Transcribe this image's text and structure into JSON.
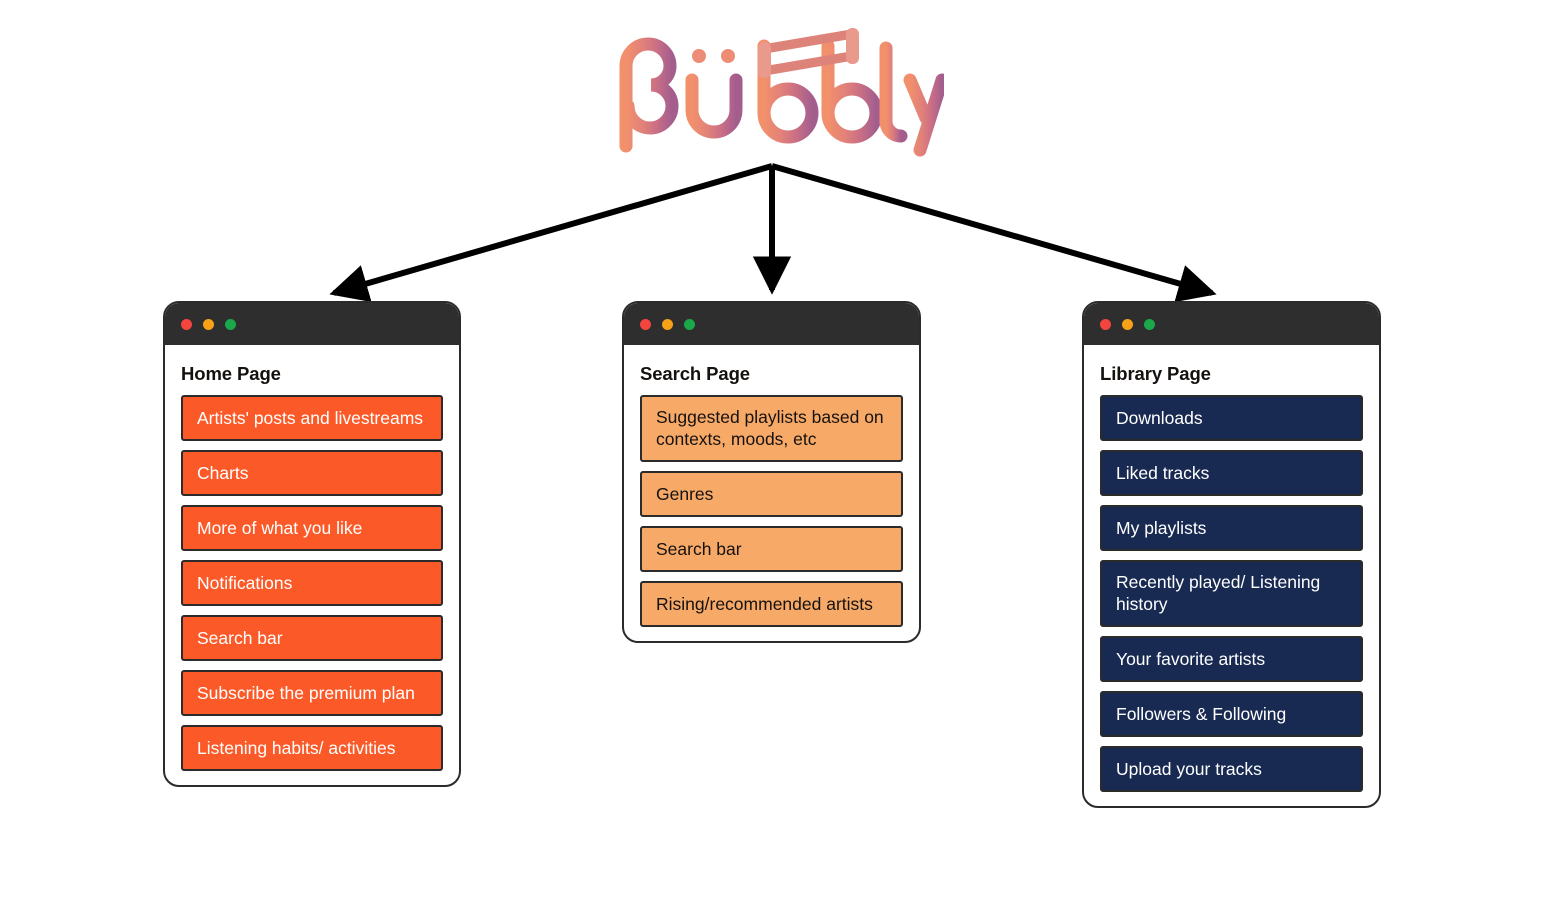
{
  "logo": {
    "name": "bubbly",
    "text": "bübbly",
    "colors": {
      "gradient_start": "#F2906C",
      "gradient_mid": "#D9757F",
      "gradient_end": "#A35E8E",
      "note_beam": "#DE8379"
    }
  },
  "diagram": {
    "connector_color": "#000000",
    "connector_count": 3
  },
  "window_controls": {
    "close_label": "close",
    "minimize_label": "minimize",
    "maximize_label": "maximize",
    "colors": {
      "close": "#F2453D",
      "minimize": "#F6A117",
      "maximize": "#1AA84A"
    }
  },
  "cards": [
    {
      "id": "home",
      "title": "Home Page",
      "accent": "#FB5A28",
      "text_color": "#FFFFFF",
      "items": [
        "Artists' posts and livestreams",
        "Charts",
        "More of what you like",
        "Notifications",
        "Search bar",
        "Subscribe the premium plan",
        "Listening habits/ activities"
      ]
    },
    {
      "id": "search",
      "title": "Search Page",
      "accent": "#F7A967",
      "text_color": "#16120F",
      "items": [
        "Suggested playlists based on contexts, moods, etc",
        "Genres",
        "Search bar",
        "Rising/recommended artists"
      ]
    },
    {
      "id": "library",
      "title": "Library Page",
      "accent": "#182A51",
      "text_color": "#FFFFFF",
      "items": [
        "Downloads",
        "Liked tracks",
        "My playlists",
        "Recently played/ Listening history",
        "Your favorite artists",
        "Followers & Following",
        "Upload your tracks"
      ]
    }
  ]
}
